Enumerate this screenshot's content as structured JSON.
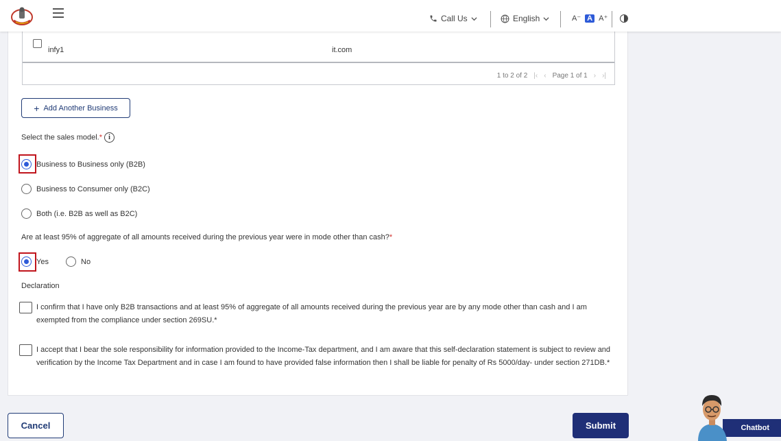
{
  "header": {
    "call_us": "Call Us",
    "language": "English",
    "font_decrease": "A⁻",
    "font_normal": "A",
    "font_increase": "A⁺"
  },
  "table": {
    "rows": [
      {
        "name": "infy1",
        "domain": "it.com",
        "checked": false
      }
    ],
    "pager": {
      "range": "1 to 2 of 2",
      "page": "Page 1 of 1"
    }
  },
  "add_business": {
    "label": "Add Another Business"
  },
  "sales_model": {
    "question": "Select the sales model.",
    "required_mark": "*",
    "options": [
      {
        "label": "Business to Business only (B2B)",
        "selected": true
      },
      {
        "label": "Business to Consumer only (B2C)",
        "selected": false
      },
      {
        "label": "Both (i.e. B2B as well as B2C)",
        "selected": false
      }
    ]
  },
  "cash_question": {
    "question": "Are at least 95% of aggregate of all amounts received during the previous year were in mode other than cash?",
    "required_mark": "*",
    "yes": "Yes",
    "no": "No",
    "selected": "Yes"
  },
  "declaration": {
    "title": "Declaration",
    "items": [
      {
        "text": "I confirm that I have only B2B transactions and at least 95% of aggregate of all amounts received during the previous year are by any mode other than cash and I am exempted from the compliance under section 269SU.*",
        "checked": false
      },
      {
        "text": "I accept that I bear the sole responsibility for information provided to the Income-Tax department, and I am aware that this self-declaration statement is subject to review and verification by the Income Tax Department and in case I am found to have provided false information then I shall be liable for penalty of Rs 5000/day- under section 271DB.*",
        "checked": false
      }
    ]
  },
  "actions": {
    "cancel": "Cancel",
    "submit": "Submit"
  },
  "chatbot": {
    "label": "Chatbot"
  },
  "colors": {
    "primary": "#1f2f77",
    "accent": "#2e5bd8",
    "highlight": "#c0141c",
    "required": "#d0312d"
  }
}
